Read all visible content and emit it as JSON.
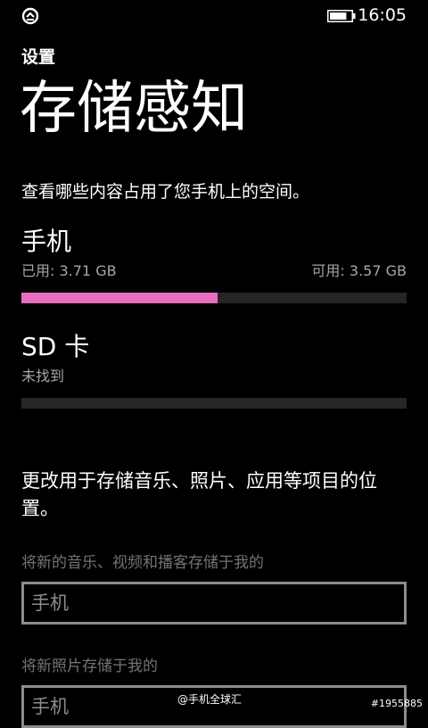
{
  "status_bar": {
    "time": "16:05",
    "sync_icon": "sync-icon",
    "battery_icon": "battery-icon",
    "battery_level_fraction": 0.8
  },
  "header": {
    "app_title": "设置",
    "page_title": "存储感知"
  },
  "description": "查看哪些内容占用了您手机上的空间。",
  "phone": {
    "title": "手机",
    "used": "已用: 3.71 GB",
    "available": "可用: 3.57 GB",
    "used_fraction": 0.51
  },
  "sd_card": {
    "title": "SD 卡",
    "status": "未找到",
    "used_fraction": 0
  },
  "change_location_text": "更改用于存储音乐、照片、应用等项目的位置。",
  "music_setting": {
    "label": "将新的音乐、视频和播客存储于我的",
    "value": "手机"
  },
  "photos_setting": {
    "label": "将新照片存储于我的",
    "value": "手机"
  },
  "watermark": {
    "text": "@手机全球汇",
    "id": "#1955885"
  },
  "colors": {
    "accent": "#e76fbf",
    "background": "#000000",
    "track": "#262626",
    "secondary_text": "#a6a6a6",
    "border": "#8c8c8c"
  }
}
